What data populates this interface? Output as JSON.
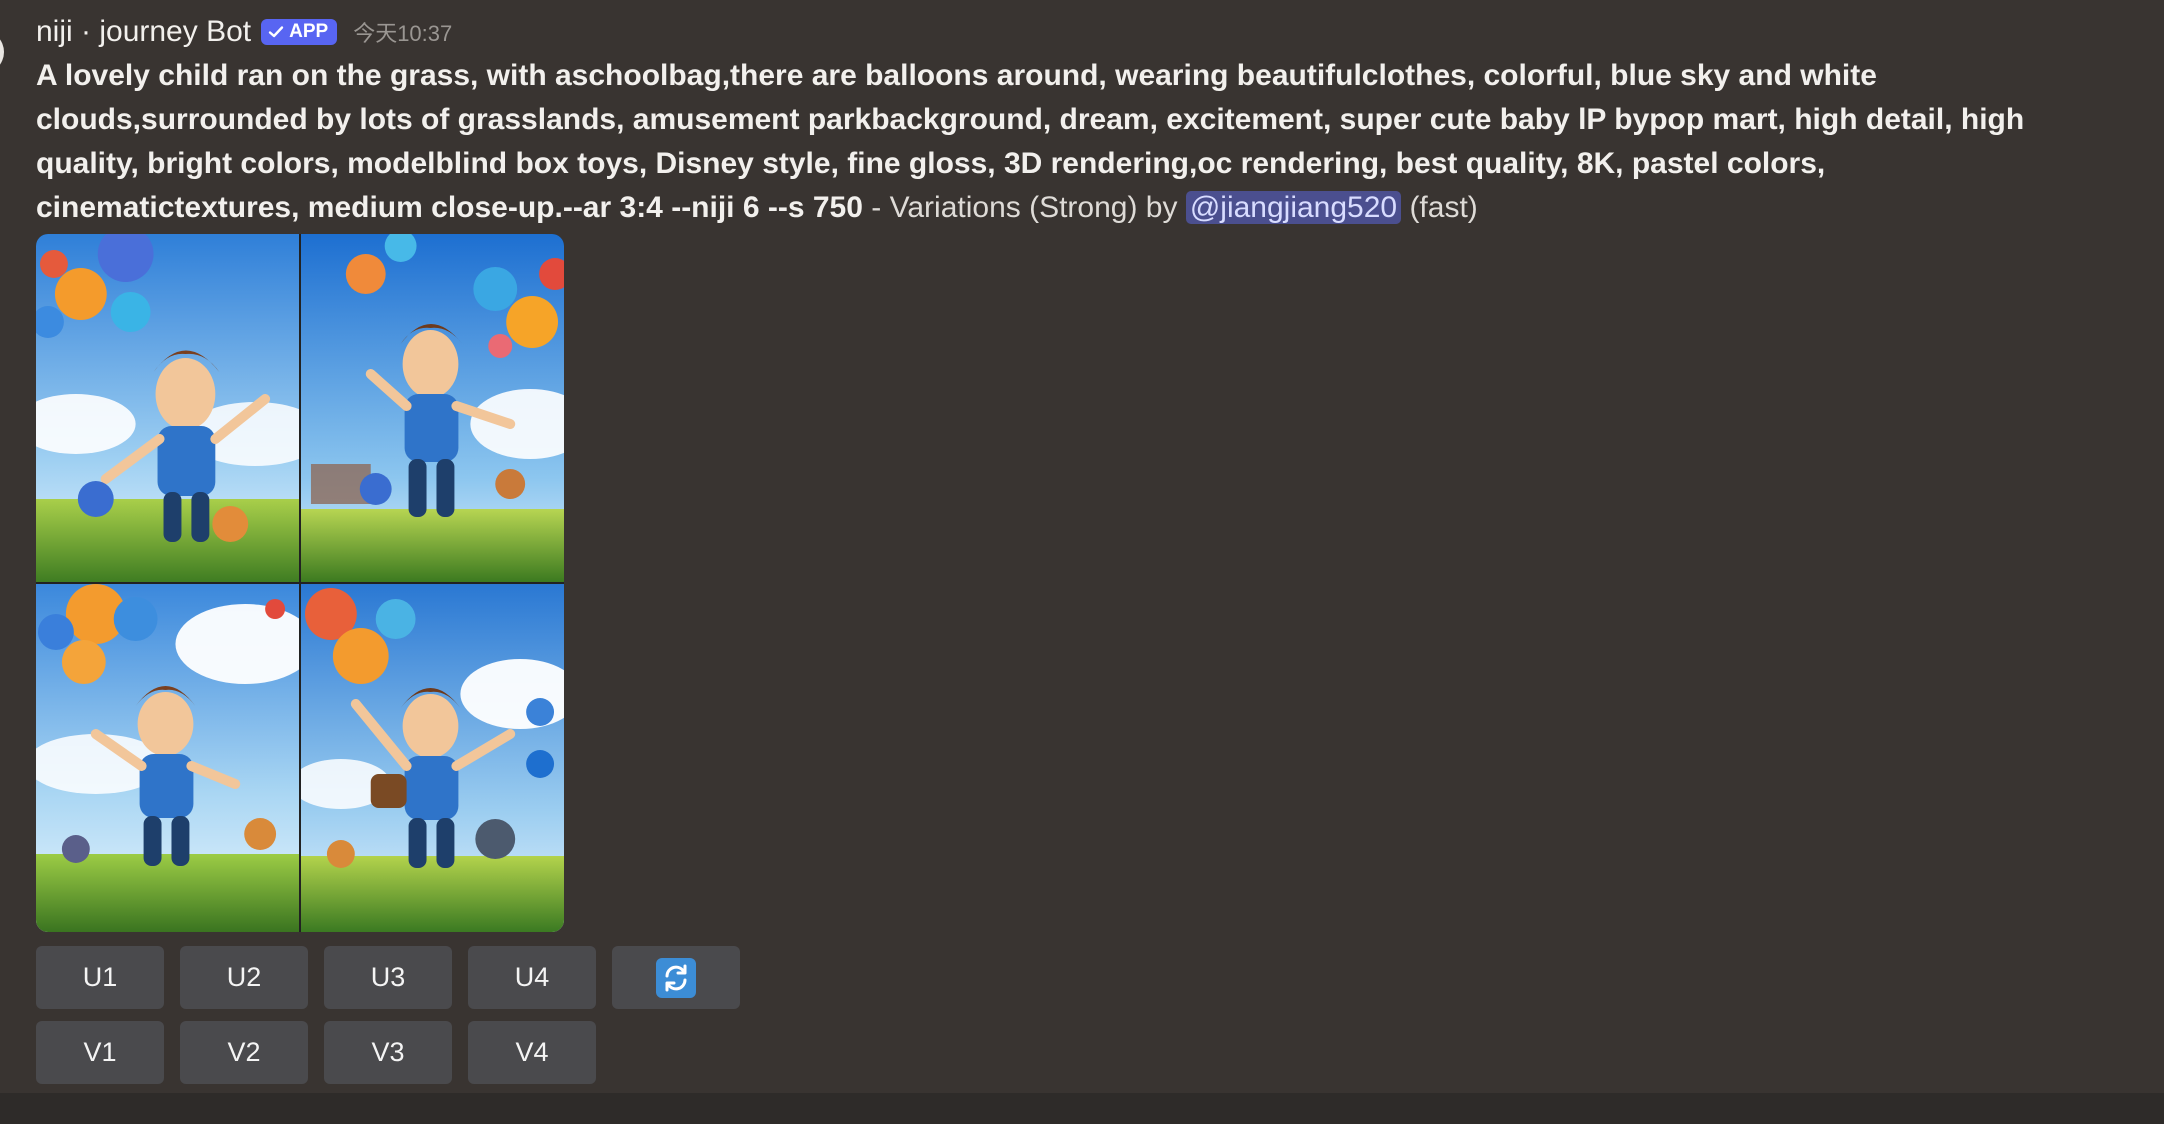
{
  "header": {
    "bot_name": "niji · journey Bot",
    "badge": "APP",
    "timestamp": "今天10:37"
  },
  "message": {
    "prompt": "A lovely child ran on the grass, with aschoolbag,there are balloons around, wearing beautifulclothes, colorful, blue sky and white clouds,surrounded by lots of grasslands, amusement parkbackground, dream, excitement, super cute baby lP bypop mart, high detail, high quality, bright colors, modelblind box toys, Disney style, fine gloss, 3D rendering,oc rendering, best quality, 8K, pastel colors, cinematictextures, medium close-up.--ar 3:4 --niji 6 --s 750",
    "variation_text": " - Variations (Strong) by ",
    "mention": "@jiangjiang520",
    "speed": " (fast)"
  },
  "buttons": {
    "upscale": [
      "U1",
      "U2",
      "U3",
      "U4"
    ],
    "variation": [
      "V1",
      "V2",
      "V3",
      "V4"
    ],
    "reroll_icon": "refresh-icon"
  },
  "colors": {
    "background": "#393431",
    "badge": "#5865f2",
    "mention_bg": "#4b4f8f",
    "button": "#4a4a4d",
    "reroll": "#3c8dd6"
  }
}
